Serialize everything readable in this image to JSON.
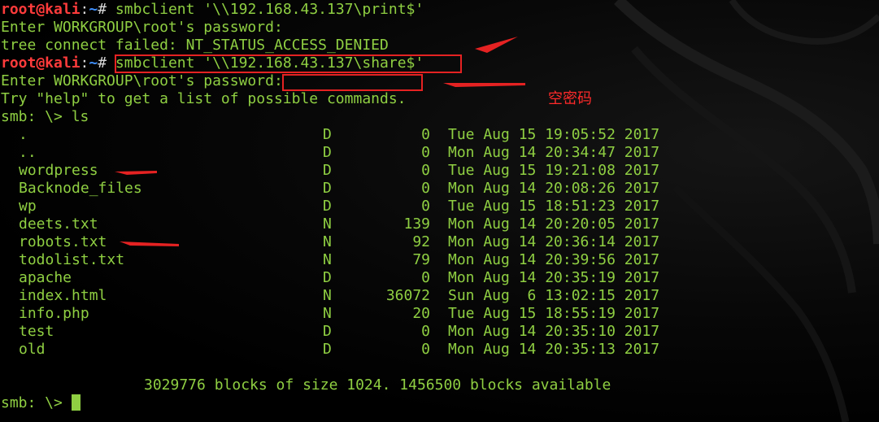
{
  "terminal": {
    "line1": {
      "user": "root@kali",
      "path": "~",
      "sym": "# ",
      "cmd": "smbclient '\\\\192.168.43.137\\print$'"
    },
    "line2": "Enter WORKGROUP\\root's password:",
    "line3": "tree connect failed: NT_STATUS_ACCESS_DENIED",
    "line4": {
      "user": "root@kali",
      "path": "~",
      "sym": "# ",
      "cmd": "smbclient '\\\\192.168.43.137\\share$'"
    },
    "line5": "Enter WORKGROUP\\root's password:",
    "line6": "Try \"help\" to get a list of possible commands.",
    "line7": "smb: \\> ls",
    "blocks_line": "3029776 blocks of size 1024. 1456500 blocks available",
    "final_prompt": "smb: \\> "
  },
  "listing": [
    {
      "name": ".",
      "type": "D",
      "size": "0",
      "date": "Tue Aug 15 19:05:52 2017"
    },
    {
      "name": "..",
      "type": "D",
      "size": "0",
      "date": "Mon Aug 14 20:34:47 2017"
    },
    {
      "name": "wordpress",
      "type": "D",
      "size": "0",
      "date": "Tue Aug 15 19:21:08 2017"
    },
    {
      "name": "Backnode_files",
      "type": "D",
      "size": "0",
      "date": "Mon Aug 14 20:08:26 2017"
    },
    {
      "name": "wp",
      "type": "D",
      "size": "0",
      "date": "Tue Aug 15 18:51:23 2017"
    },
    {
      "name": "deets.txt",
      "type": "N",
      "size": "139",
      "date": "Mon Aug 14 20:20:05 2017"
    },
    {
      "name": "robots.txt",
      "type": "N",
      "size": "92",
      "date": "Mon Aug 14 20:36:14 2017"
    },
    {
      "name": "todolist.txt",
      "type": "N",
      "size": "79",
      "date": "Mon Aug 14 20:39:56 2017"
    },
    {
      "name": "apache",
      "type": "D",
      "size": "0",
      "date": "Mon Aug 14 20:35:19 2017"
    },
    {
      "name": "index.html",
      "type": "N",
      "size": "36072",
      "date": "Sun Aug  6 13:02:15 2017"
    },
    {
      "name": "info.php",
      "type": "N",
      "size": "20",
      "date": "Tue Aug 15 18:55:19 2017"
    },
    {
      "name": "test",
      "type": "D",
      "size": "0",
      "date": "Mon Aug 14 20:35:10 2017"
    },
    {
      "name": "old",
      "type": "D",
      "size": "0",
      "date": "Mon Aug 14 20:35:13 2017"
    }
  ],
  "annotation": {
    "note": "空密码",
    "color": "#e52222"
  },
  "colors": {
    "text": "#8fcf42",
    "prompt_user": "#ff3b3b",
    "prompt_path": "#3f8fff",
    "background": "#000000"
  }
}
